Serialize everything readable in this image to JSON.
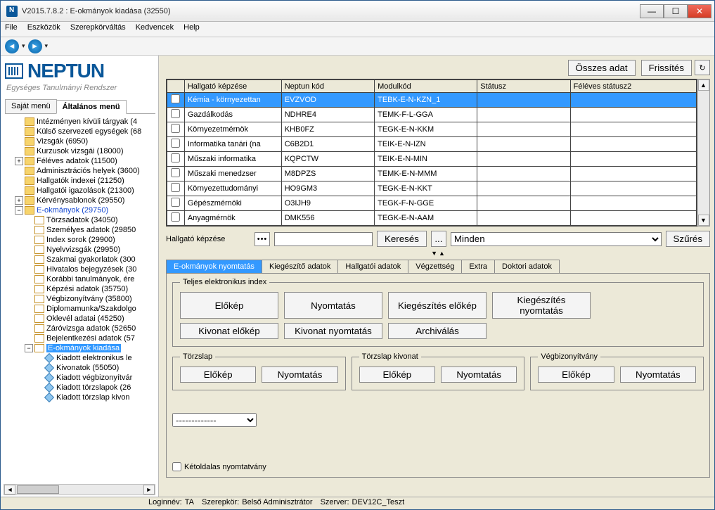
{
  "window": {
    "title": "V2015.7.8.2 : E-okmányok kiadása (32550)"
  },
  "menu": {
    "file": "File",
    "tools": "Eszközök",
    "roleswitch": "Szerepkörváltás",
    "favorites": "Kedvencek",
    "help": "Help"
  },
  "logo": {
    "text": "NEPTUN",
    "tagline": "Egységes Tanulmányi Rendszer"
  },
  "left_tabs": {
    "own": "Saját menü",
    "general": "Általános menü"
  },
  "tree": {
    "n0": "Intézményen kívüli tárgyak (4",
    "n1": "Külső szervezeti egységek (68",
    "n2": "Vizsgák (6950)",
    "n3": "Kurzusok vizsgái (18000)",
    "n4": "Féléves adatok (11500)",
    "n5": "Adminisztrációs helyek (3600)",
    "n6": "Hallgatók indexei (21250)",
    "n7": "Hallgatói igazolások (21300)",
    "n8": "Kérvénysablonok (29550)",
    "n9": "E-okmányok (29750)",
    "n10": "Törzsadatok (34050)",
    "n11": "Személyes adatok (29850",
    "n12": "Index sorok (29900)",
    "n13": "Nyelvvizsgák (29950)",
    "n14": "Szakmai gyakorlatok (300",
    "n15": "Hivatalos bejegyzések (30",
    "n16": "Korábbi tanulmányok, ére",
    "n17": "Képzési adatok (35750)",
    "n18": "Végbizonyítvány (35800)",
    "n19": "Diplomamunka/Szakdolgo",
    "n20": "Oklevél adatai (45250)",
    "n21": "Záróvizsga adatok (52650",
    "n22": "Bejelentkezési adatok (57",
    "n23": "E-okmányok kiadása",
    "n24": "Kiadott elektronikus le",
    "n25": "Kivonatok (55050)",
    "n26": "Kiadott végbizonyítvár",
    "n27": "Kiadott törzslapok (26",
    "n28": "Kiadott törzslap kivon"
  },
  "topbuttons": {
    "all": "Összes adat",
    "refresh": "Frissítés"
  },
  "grid": {
    "headers": {
      "h1": "Hallgató képzése",
      "h2": "Neptun kód",
      "h3": "Modulkód",
      "h4": "Státusz",
      "h5": "Féléves státusz2"
    },
    "rows": [
      {
        "a": "Kémia - környezettan",
        "b": "EVZVOD",
        "c": "TEBK-E-N-KZN_1"
      },
      {
        "a": "Gazdálkodás",
        "b": "NDHRE4",
        "c": "TEMK-F-L-GGA"
      },
      {
        "a": "Környezetmérnök",
        "b": "KHB0FZ",
        "c": "TEGK-E-N-KKM"
      },
      {
        "a": "Informatika tanári (na",
        "b": "C6B2D1",
        "c": "TEIK-E-N-IZN"
      },
      {
        "a": "Műszaki informatika",
        "b": "KQPCTW",
        "c": "TEIK-E-N-MIN"
      },
      {
        "a": "Műszaki menedzser",
        "b": "M8DPZS",
        "c": "TEMK-E-N-MMM"
      },
      {
        "a": "Környezettudományi",
        "b": "HO9GM3",
        "c": "TEGK-E-N-KKT"
      },
      {
        "a": "Gépészmérnöki",
        "b": "O3IJH9",
        "c": "TEGK-F-N-GGE"
      },
      {
        "a": "Anyagmérnök",
        "b": "DMK556",
        "c": "TEGK-E-N-AAM"
      }
    ]
  },
  "search": {
    "label": "Hallgató képzése",
    "btn": "Keresés",
    "dots": "...",
    "all": "Minden",
    "filter": "Szűrés"
  },
  "tabs": {
    "t1": "E-okmányok nyomtatás",
    "t2": "Kiegészítő adatok",
    "t3": "Hallgatói adatok",
    "t4": "Végzettség",
    "t5": "Extra",
    "t6": "Doktori adatok"
  },
  "box1": {
    "legend": "Teljes elektronikus index",
    "preview": "Előkép",
    "print": "Nyomtatás",
    "supp_preview": "Kiegészítés előkép",
    "supp_print": "Kiegészítés nyomtatás",
    "ext_preview": "Kivonat előkép",
    "ext_print": "Kivonat nyomtatás",
    "archive": "Archiválás"
  },
  "box2": {
    "legend": "Törzslap",
    "preview": "Előkép",
    "print": "Nyomtatás"
  },
  "box3": {
    "legend": "Törzslap kivonat",
    "preview": "Előkép",
    "print": "Nyomtatás"
  },
  "box4": {
    "legend": "Végbizonyítvány",
    "preview": "Előkép",
    "print": "Nyomtatás"
  },
  "combo": {
    "value": "-------------"
  },
  "dup": "Kétoldalas nyomtatvány",
  "status": {
    "login_l": "Loginnév:",
    "login_v": "TA",
    "role_l": "Szerepkör:",
    "role_v": "Belső Adminisztrátor",
    "srv_l": "Szerver:",
    "srv_v": "DEV12C_Teszt"
  }
}
